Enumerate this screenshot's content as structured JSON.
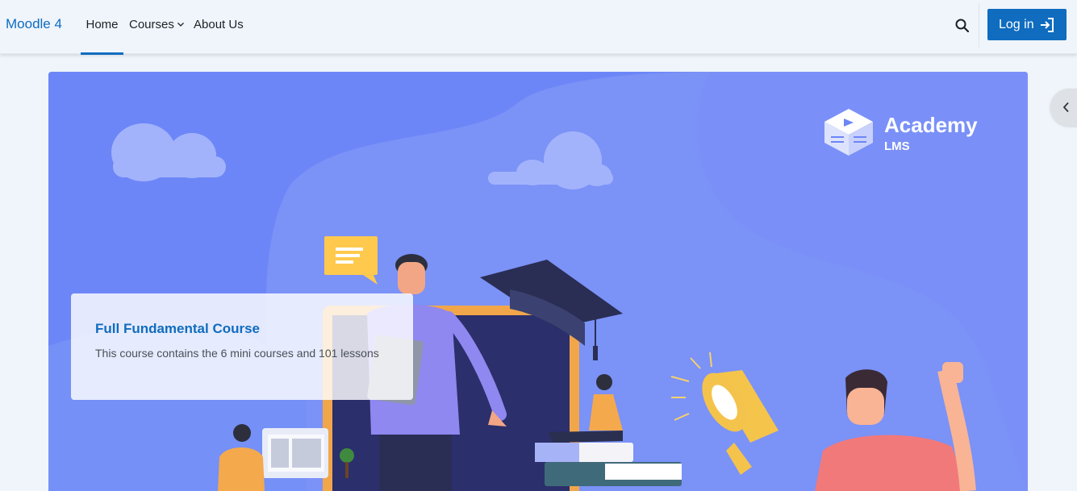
{
  "navbar": {
    "brand": "Moodle 4",
    "items": [
      {
        "label": "Home",
        "active": true
      },
      {
        "label": "Courses",
        "has_dropdown": true
      },
      {
        "label": "About Us"
      }
    ],
    "search_icon": "search-icon",
    "login_label": "Log in",
    "login_icon": "sign-in-icon"
  },
  "drawer": {
    "toggle_icon": "chevron-left-icon"
  },
  "banner": {
    "logo_title": "Academy",
    "logo_subtitle": "LMS",
    "card": {
      "title": "Full Fundamental Course",
      "description": "This course contains the 6 mini courses and 101 lessons"
    }
  },
  "colors": {
    "brand": "#0f6cbf",
    "banner_bg": "#6d86f7",
    "page_bg": "#eff5fb"
  }
}
